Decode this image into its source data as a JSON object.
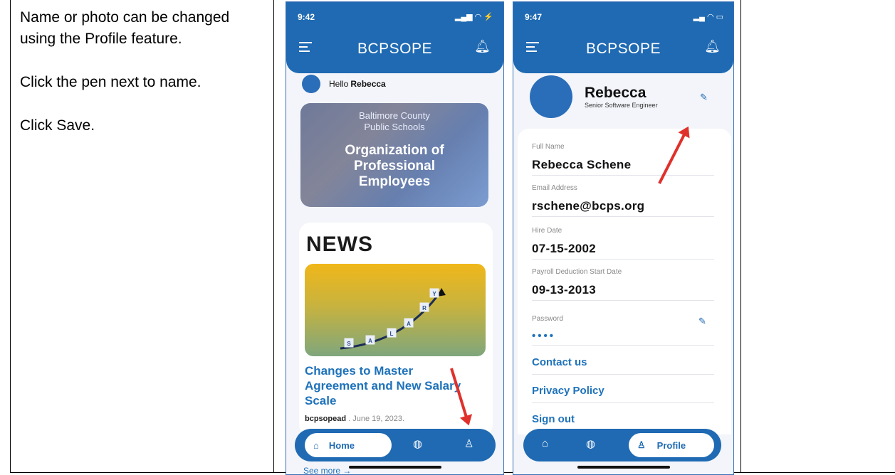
{
  "instructions": {
    "line1": "Name or photo can be changed using the Profile feature.",
    "line2": "Click the pen next to name.",
    "line3": "Click Save."
  },
  "screen1": {
    "time": "9:42",
    "status_icons": "▂▄▆ ◠ ⚡",
    "app_title": "BCPSOPE",
    "hello_prefix": "Hello ",
    "hello_name": "Rebecca",
    "hero_sub_line1": "Baltimore County",
    "hero_sub_line2": "Public Schools",
    "hero_title_line1": "Organization of",
    "hero_title_line2": "Professional",
    "hero_title_line3": "Employees",
    "news_heading": "NEWS",
    "scale_letters": [
      "S",
      "A",
      "L",
      "A",
      "R",
      "Y"
    ],
    "news_headline": "Changes to Master Agreement and New Salary Scale",
    "news_author": "bcpsopead",
    "news_date": ". June 19, 2023.",
    "see_more": "See more →",
    "nav_home": "Home",
    "nav_globe": "◍",
    "nav_profile": "♙"
  },
  "screen2": {
    "time": "9:47",
    "status_icons": "▂▄ ◠ ▭",
    "app_title": "BCPSOPE",
    "profile_name": "Rebecca",
    "profile_role": "Senior Software Engineer",
    "fields": [
      {
        "label": "Full Name",
        "value": "Rebecca Schene"
      },
      {
        "label": "Email Address",
        "value": "rschene@bcps.org"
      },
      {
        "label": "Hire Date",
        "value": "07-15-2002"
      },
      {
        "label": "Payroll Deduction Start Date",
        "value": "09-13-2013"
      },
      {
        "label": "Password",
        "value": "••••"
      }
    ],
    "links": [
      "Contact us",
      "Privacy Policy",
      "Sign out"
    ],
    "nav_profile": "Profile"
  },
  "colors": {
    "primary": "#1f6ab3",
    "link": "#1e72ba",
    "arrow": "#e0302b"
  },
  "icons": [
    "menu-icon",
    "bell-icon",
    "home-icon",
    "globe-icon",
    "profile-icon",
    "pen-icon"
  ]
}
